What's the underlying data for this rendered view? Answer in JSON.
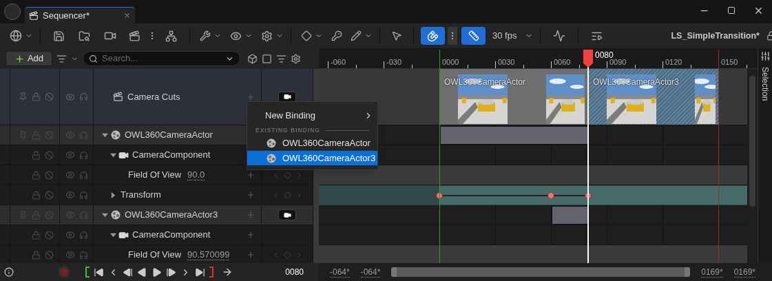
{
  "title_bar": {
    "tab": {
      "label": "Sequencer*"
    }
  },
  "toolbar": {
    "toggles": [
      {
        "on": true
      },
      {
        "on": true
      }
    ],
    "fps": "30 fps",
    "sequence_name": "LS_SimpleTransition*"
  },
  "track_header": {
    "add_button": "Add",
    "search": {
      "placeholder": "Search..."
    }
  },
  "ruler": {
    "ticks": [
      "-060",
      "-030",
      "0000",
      "0030",
      "0060",
      "0090",
      "0120",
      "0150"
    ],
    "playhead": "0080"
  },
  "tracks": [
    {
      "kind": "camera_cuts",
      "label": "Camera Cuts",
      "sections": [
        {
          "label": "OWL360CameraActor",
          "selected": false
        },
        {
          "label": "OWL360CameraActor3",
          "selected": true
        }
      ]
    },
    {
      "kind": "actor",
      "label": "OWL360CameraActor",
      "expanded": true,
      "children": [
        {
          "kind": "component",
          "label": "CameraComponent",
          "expanded": true,
          "children": [
            {
              "kind": "property",
              "label": "Field Of View",
              "value": "90.0"
            }
          ]
        },
        {
          "kind": "transform",
          "label": "Transform",
          "expanded": false
        }
      ]
    },
    {
      "kind": "actor",
      "label": "OWL360CameraActor3",
      "expanded": true,
      "children": [
        {
          "kind": "component",
          "label": "CameraComponent",
          "expanded": true,
          "children": [
            {
              "kind": "property",
              "label": "Field Of View",
              "value": "90.570099"
            }
          ]
        }
      ]
    }
  ],
  "context_menu": {
    "new_binding": "New Binding",
    "heading": "EXISTING BINDING",
    "items": [
      {
        "label": "OWL360CameraActor",
        "selected": false
      },
      {
        "label": "OWL360CameraActor3",
        "selected": true
      }
    ]
  },
  "side_tab": "Selection",
  "transport": {
    "time": "0080"
  },
  "view_range": [
    "-064*",
    "-064*",
    "0169*",
    "0169*"
  ]
}
